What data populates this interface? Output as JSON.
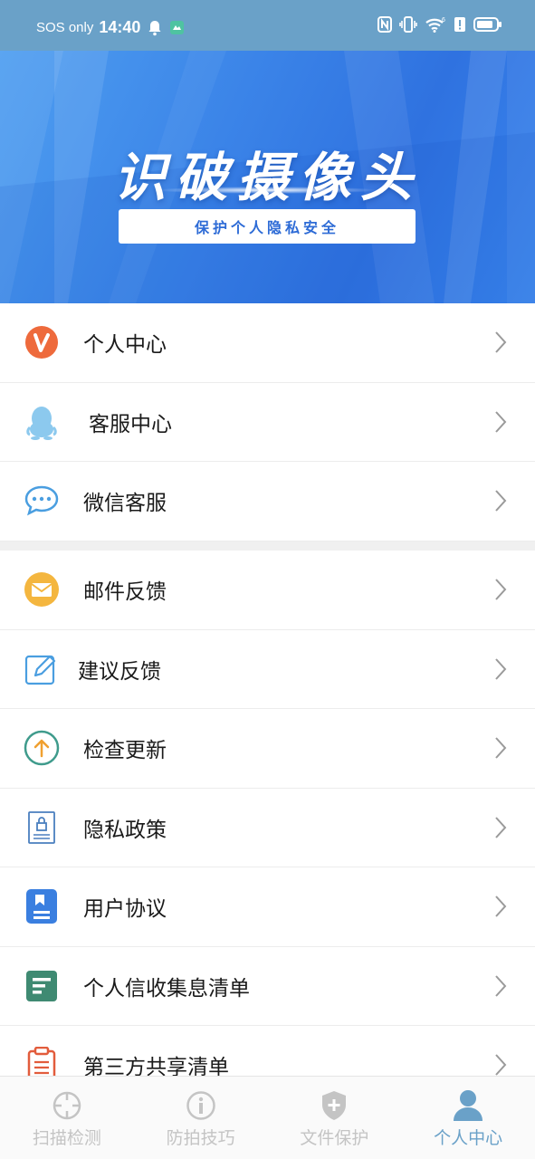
{
  "status_bar": {
    "carrier": "SOS only",
    "time": "14:40",
    "icons": [
      "bell-icon",
      "app-notification-icon",
      "nfc-icon",
      "vibrate-icon",
      "wifi-icon",
      "alert-icon",
      "battery-icon"
    ]
  },
  "banner": {
    "title": "识破摄像头",
    "subtitle": "保护个人隐私安全"
  },
  "menu": {
    "group1": [
      {
        "label": "个人中心",
        "icon": "v-badge-icon"
      },
      {
        "label": "客服中心",
        "icon": "penguin-icon"
      },
      {
        "label": "微信客服",
        "icon": "chat-bubble-icon"
      }
    ],
    "group2": [
      {
        "label": "邮件反馈",
        "icon": "mail-icon"
      },
      {
        "label": "建议反馈",
        "icon": "edit-icon"
      },
      {
        "label": "检查更新",
        "icon": "upload-arrow-icon"
      },
      {
        "label": "隐私政策",
        "icon": "lock-document-icon"
      },
      {
        "label": "用户协议",
        "icon": "user-agreement-icon"
      },
      {
        "label": "个人信收集息清单",
        "icon": "list-document-icon"
      },
      {
        "label": "第三方共享清单",
        "icon": "clipboard-icon"
      }
    ]
  },
  "bottom_nav": [
    {
      "label": "扫描检测",
      "icon": "crosshair-icon",
      "active": false
    },
    {
      "label": "防拍技巧",
      "icon": "info-icon",
      "active": false
    },
    {
      "label": "文件保护",
      "icon": "shield-icon",
      "active": false
    },
    {
      "label": "个人中心",
      "icon": "person-icon",
      "active": true
    }
  ],
  "colors": {
    "status_bar": "#6aa1c8",
    "banner": "#3b84e8",
    "nav_active": "#6aa1c8",
    "nav_inactive": "#c4c4c4"
  }
}
